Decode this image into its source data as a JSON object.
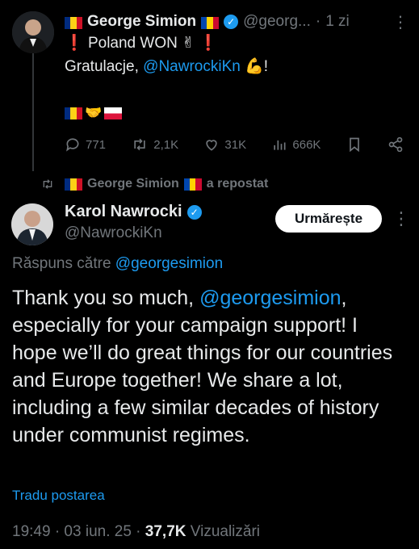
{
  "top_tweet": {
    "author_name": "George Simion",
    "handle": "@georg...",
    "time": "1 zi",
    "line1_text": "Poland WON",
    "line2_prefix": "Gratulacje, ",
    "line2_mention": "@NawrockiKn",
    "actions": {
      "replies": "771",
      "reposts": "2,1K",
      "likes": "31K",
      "views": "666K"
    }
  },
  "repost_note": {
    "author_name": "George Simion",
    "suffix": "a repostat"
  },
  "main_tweet": {
    "author_name": "Karol Nawrocki",
    "handle": "@NawrockiKn",
    "follow_label": "Urmărește",
    "replying_prefix": "Răspuns către ",
    "replying_handle": "@georgesimion",
    "body_part1": "Thank you so much, ",
    "body_mention": "@georgesimion",
    "body_part2": ", especially for your campaign support! I hope we’ll do great things for our countries and Europe together! We share a lot, including a few similar decades of history under communist regimes.",
    "translate_label": "Tradu postarea",
    "timestamp": "19:49 · 03 iun. 25 · ",
    "views_count": "37,7K",
    "views_label": " Vizualizări"
  },
  "icons": [
    "reply-icon",
    "repost-icon",
    "like-icon",
    "views-icon",
    "bookmark-icon",
    "share-icon",
    "more-icon",
    "verified-icon"
  ],
  "colors": {
    "accent": "#1d9bf0",
    "background": "#000000",
    "text": "#e7e9ea",
    "muted": "#71767b"
  }
}
